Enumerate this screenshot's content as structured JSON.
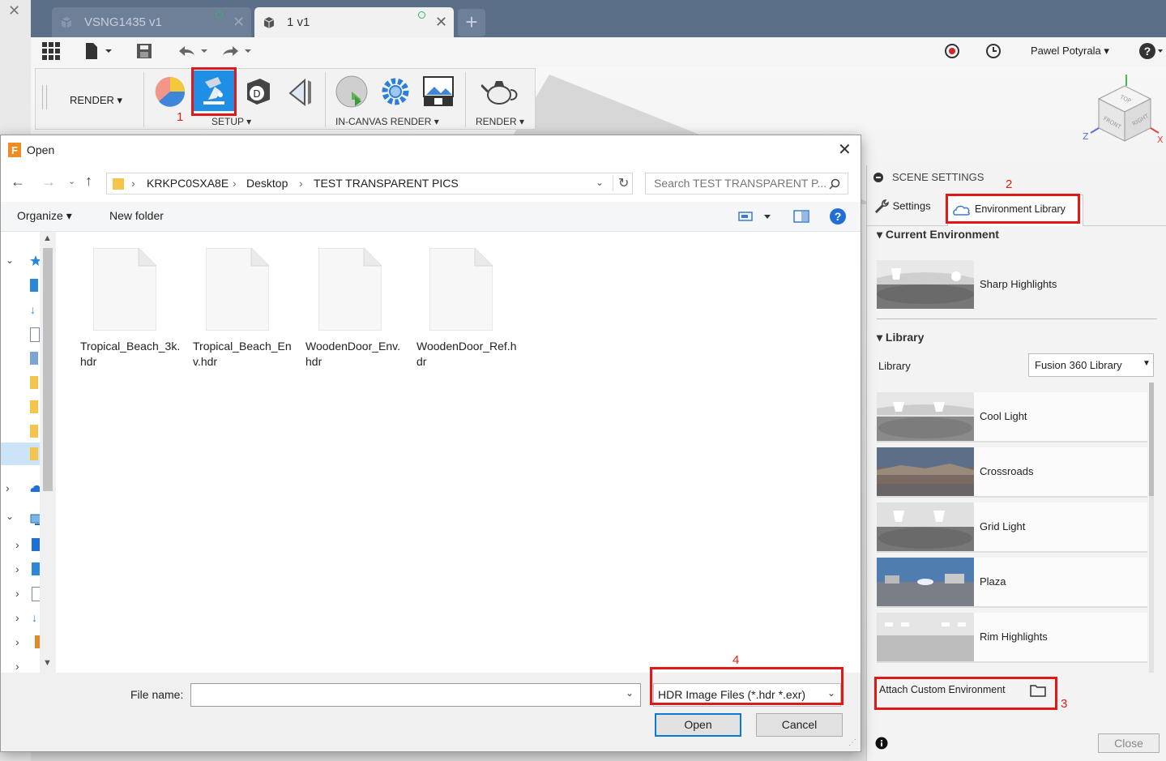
{
  "app": {
    "tabs": [
      {
        "label": "VSNG1435 v1",
        "active": false
      },
      {
        "label": "1 v1",
        "active": true
      }
    ],
    "user_name": "Pawel Potyrala"
  },
  "toolbar": {
    "workspace_label": "RENDER",
    "groups": [
      {
        "label": "SETUP"
      },
      {
        "label": "IN-CANVAS RENDER"
      },
      {
        "label": "RENDER"
      }
    ]
  },
  "annotations": [
    "1",
    "2",
    "3",
    "4"
  ],
  "viewcube": {
    "top": "TOP",
    "front": "FRONT",
    "right": "RIGHT",
    "z_axis": "Z",
    "x_axis": "X"
  },
  "scene_settings": {
    "title": "SCENE SETTINGS",
    "tabs": [
      {
        "label": "Settings",
        "icon": "wrench-icon",
        "active": false
      },
      {
        "label": "Environment Library",
        "icon": "cloud-icon",
        "active": true
      }
    ],
    "current_environment_heading": "Current Environment",
    "current_environment": "Sharp Highlights",
    "library_heading": "Library",
    "library_label": "Library",
    "library_value": "Fusion 360 Library",
    "environments": [
      "Cool Light",
      "Crossroads",
      "Grid Light",
      "Plaza",
      "Rim Highlights"
    ],
    "attach_label": "Attach Custom Environment",
    "close_label": "Close"
  },
  "dialog": {
    "title": "Open",
    "breadcrumb": [
      "KRKPC0SXA8E",
      "Desktop",
      "TEST TRANSPARENT PICS"
    ],
    "search_placeholder": "Search TEST TRANSPARENT P...",
    "organize_label": "Organize",
    "new_folder_label": "New folder",
    "files": [
      "Tropical_Beach_3k.hdr",
      "Tropical_Beach_Env.hdr",
      "WoodenDoor_Env.hdr",
      "WoodenDoor_Ref.hdr"
    ],
    "file_name_label": "File name:",
    "file_name_value": "",
    "file_type": "HDR Image Files (*.hdr *.exr)",
    "open_label": "Open",
    "cancel_label": "Cancel"
  },
  "colors": {
    "accent": "#0a7bd4",
    "annotation": "#e01818",
    "tabbar": "#5b6f89"
  }
}
